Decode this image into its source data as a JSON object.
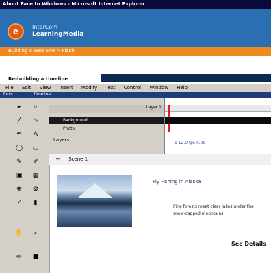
{
  "titlebar": {
    "text": "About Face to Windows - Microsoft Internet Explorer"
  },
  "banner": {
    "logo_letter": "e",
    "brand_line1": "InterCom",
    "brand_line2": "LearningMedia"
  },
  "orangebar": {
    "text": "Building a Web Site > Flash"
  },
  "lesson": {
    "title": "Re-building a timeline"
  },
  "menu": {
    "items": [
      "File",
      "Edit",
      "View",
      "Insert",
      "Modify",
      "Text",
      "Control",
      "Window",
      "Help"
    ]
  },
  "panels": {
    "left_label": "Tools",
    "right_label": "Timeline"
  },
  "timeline": {
    "frame_header": "Layer 1",
    "layer1": "Background",
    "layer2": "Photo",
    "layer3": "Layers",
    "status": "1  12.0 fps  0.0s"
  },
  "scene": {
    "label": "Scene 1"
  },
  "stage": {
    "title": "Fly Fishing in Alaska",
    "text1": "Pine forests meet clear lakes under the",
    "text2": "snow-capped mountains",
    "bottom": "See Details"
  }
}
